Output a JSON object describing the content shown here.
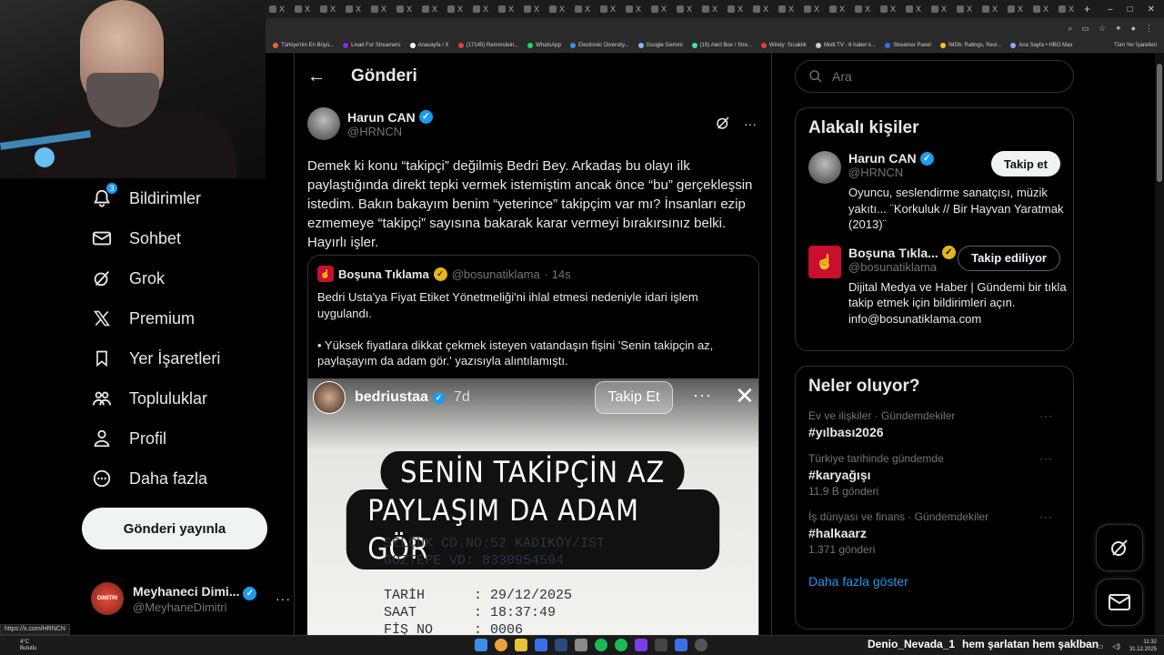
{
  "browser": {
    "tabs": [
      "X",
      "X",
      "X",
      "X",
      "X",
      "X",
      "X",
      "X",
      "X",
      "X",
      "X",
      "X",
      "X",
      "X",
      "X",
      "X",
      "X",
      "X",
      "X",
      "X",
      "X",
      "X",
      "X",
      "X",
      "X",
      "X",
      "X",
      "X",
      "X",
      "X",
      "X",
      "X"
    ],
    "new_tab": "+",
    "window_controls": [
      "–",
      "□",
      "✕"
    ],
    "bookmarks": [
      "Türkiye'nin En Büyü...",
      "Livad For Streamers",
      "Anasayfa / X",
      "(17145) Rammstein...",
      "WhatsApp",
      "Electronic Diversity...",
      "Google Gemini",
      "(19) Alert Box / Stre...",
      "Windy: Sıcaklık",
      "Multi TV - 6 haber k...",
      "Streamer Panel",
      "IMDb: Ratings, Revi...",
      "Ana Sayfa • HBO Max"
    ],
    "all_bookmarks": "Tüm Yer İşaretleri",
    "status_url": "https://x.com/HRNCN"
  },
  "nav": {
    "items": [
      {
        "label": "Bildirimler",
        "icon": "bell-icon",
        "badge": "3"
      },
      {
        "label": "Sohbet",
        "icon": "mail-icon"
      },
      {
        "label": "Grok",
        "icon": "grok-icon"
      },
      {
        "label": "Premium",
        "icon": "x-logo-icon"
      },
      {
        "label": "Yer İşaretleri",
        "icon": "bookmark-icon"
      },
      {
        "label": "Topluluklar",
        "icon": "communities-icon"
      },
      {
        "label": "Profil",
        "icon": "person-icon"
      },
      {
        "label": "Daha fazla",
        "icon": "more-circle-icon"
      }
    ],
    "post_button": "Gönderi yayınla",
    "account": {
      "name": "Meyhaneci Dimi...",
      "handle": "@MeyhaneDimitri",
      "avatar_text": "DIMITRI",
      "more": "···"
    }
  },
  "main": {
    "back": "←",
    "title": "Gönderi",
    "tweet": {
      "author": "Harun CAN",
      "handle": "@HRNCN",
      "more": "···",
      "text": "Demek ki konu “takipçi” değilmiş Bedri Bey. Arkadaş bu olayı ilk paylaştığında direkt tepki vermek istemiştim ancak önce “bu” gerçekleşsin istedim. Bakın bakayım benim “yeterince” takipçim var mı? İnsanları ezip ezmemeye “takipçi” sayısına bakarak karar vermeyi bırakırsınız belki. Hayırlı işler."
    },
    "quote": {
      "author": "Boşuna Tıklama",
      "handle": "@bosunatiklama",
      "time": "· 14s",
      "text": "Bedri Usta'ya Fiyat Etiket Yönetmeliği'ni ihlal etmesi nedeniyle idari işlem uygulandı.\n\n• Yüksek fiyatlara dikkat çekmek isteyen vatandaşın fişini 'Senin takipçin az, paylaşayım da adam gör.' yazısıyla alıntılamıştı."
    },
    "story": {
      "user": "bedriustaa",
      "time": "7d",
      "follow": "Takip Et",
      "more": "···",
      "close": "✕",
      "caption_line1": "SENİN TAKİPÇİN AZ",
      "caption_line2": "PAYLAŞIM DA ADAM GÖR",
      "receipt": "SELÇUK CD.NO:52 KADIKÖY/IST\nGÖZTEPE VD: 8330954594\n\nTARİH      : 29/12/2025\nSAAT       : 18:37:49\nFİŞ NO     : 0006"
    }
  },
  "right": {
    "search_placeholder": "Ara",
    "related_title": "Alakalı kişiler",
    "people": [
      {
        "name": "Harun CAN",
        "handle": "@HRNCN",
        "button": "Takip et",
        "bio": "Oyuncu, seslendirme sanatçısı, müzik yakıtı... ¨Korkuluk // Bir Hayvan Yaratmak (2013)¨"
      },
      {
        "name": "Boşuna Tıkla...",
        "handle": "@bosunatiklama",
        "button": "Takip ediliyor",
        "bio": "Dijital Medya ve Haber | Gündemi bir tıkla takip etmek için bildirimleri açın. info@bosunatiklama.com"
      }
    ],
    "trends_title": "Neler oluyor?",
    "trends": [
      {
        "category": "Ev ve ilişkiler · Gündemdekiler",
        "name": "#yılbası2026",
        "count": ""
      },
      {
        "category": "Türkiye tarihinde gündemde",
        "name": "#karyağışı",
        "count": "11,9 B gönderi"
      },
      {
        "category": "İş dünyası ve finans · Gündemdekiler",
        "name": "#halkaarz",
        "count": "1.371 gönderi"
      }
    ],
    "show_more": "Daha fazla göster"
  },
  "taskbar": {
    "weather_temp": "4°C",
    "weather_desc": "Bulutlu",
    "ticker_user": "Denio_Nevada_1",
    "ticker_text": "hem şarlatan hem şaklban",
    "time": "11:32",
    "date": "31.12.2025"
  },
  "colors": {
    "accent": "#1d9bf0",
    "gold_check": "#e2b719",
    "border": "#2f3336",
    "muted": "#71767b"
  }
}
